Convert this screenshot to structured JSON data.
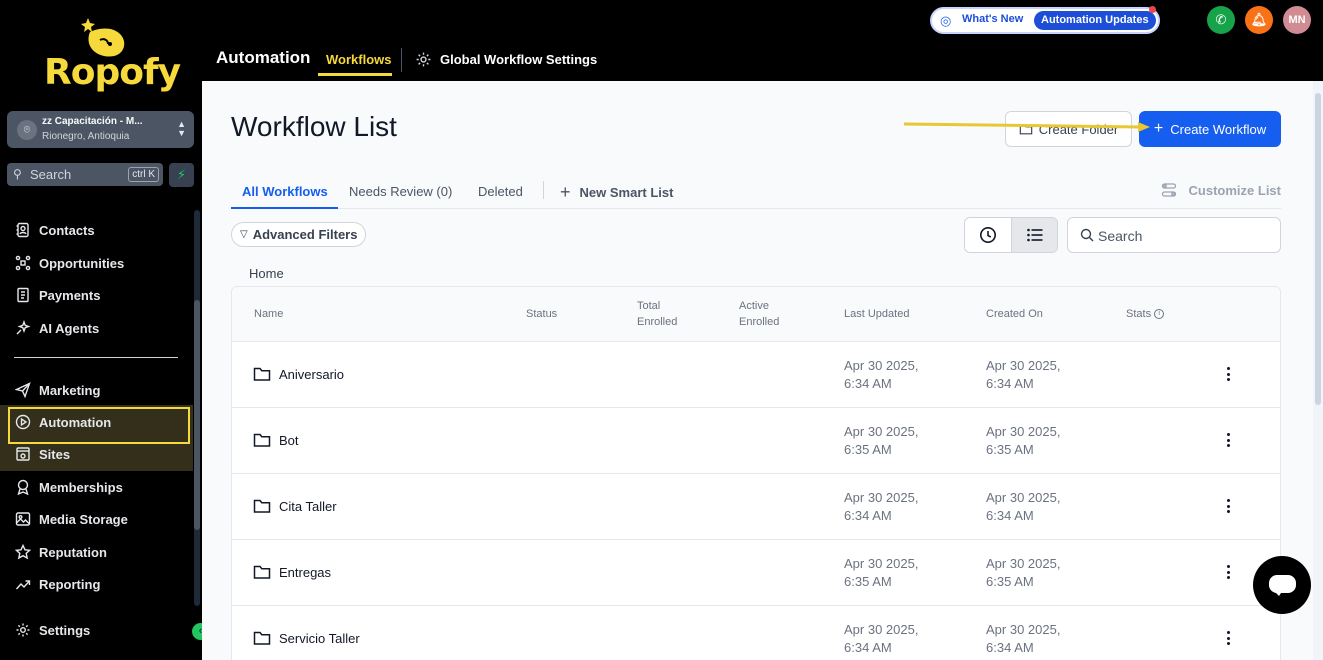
{
  "brand": {
    "logo_text": "Ropofy",
    "accent": "#f6d93b"
  },
  "account": {
    "name": "zz Capacitación - M...",
    "location": "Rionegro, Antioquia"
  },
  "sidebar": {
    "search_placeholder": "Search",
    "search_shortcut": "ctrl K",
    "items": [
      {
        "label": "Contacts",
        "icon": "contacts-icon"
      },
      {
        "label": "Opportunities",
        "icon": "opportunities-icon"
      },
      {
        "label": "Payments",
        "icon": "payments-icon"
      },
      {
        "label": "AI Agents",
        "icon": "ai-agents-icon"
      },
      {
        "label": "Marketing",
        "icon": "marketing-icon"
      },
      {
        "label": "Automation",
        "icon": "automation-icon",
        "active": true
      },
      {
        "label": "Sites",
        "icon": "sites-icon"
      },
      {
        "label": "Memberships",
        "icon": "memberships-icon"
      },
      {
        "label": "Media Storage",
        "icon": "media-storage-icon"
      },
      {
        "label": "Reputation",
        "icon": "reputation-icon"
      },
      {
        "label": "Reporting",
        "icon": "reporting-icon"
      },
      {
        "label": "Settings",
        "icon": "settings-icon"
      }
    ]
  },
  "header": {
    "whats_new": "What's New",
    "automation_updates": "Automation Updates",
    "avatar_initials": "MN",
    "app_title": "Automation",
    "tabs": [
      {
        "label": "Workflows",
        "active": true
      },
      {
        "label": "Global Workflow Settings"
      }
    ]
  },
  "main": {
    "title": "Workflow List",
    "create_folder": "Create Folder",
    "create_workflow": "Create Workflow",
    "tabs": [
      "All Workflows",
      "Needs Review (0)",
      "Deleted"
    ],
    "new_smart_list": "New Smart List",
    "customize_list": "Customize List",
    "advanced_filters": "Advanced Filters",
    "search_placeholder": "Search",
    "breadcrumb": "Home",
    "columns": [
      "Name",
      "Status",
      "Total Enrolled",
      "Active Enrolled",
      "Last Updated",
      "Created On",
      "Stats"
    ],
    "rows": [
      {
        "name": "Aniversario",
        "last_updated": "Apr 30 2025, 6:34 AM",
        "created_on": "Apr 30 2025, 6:34 AM"
      },
      {
        "name": "Bot",
        "last_updated": "Apr 30 2025, 6:35 AM",
        "created_on": "Apr 30 2025, 6:35 AM"
      },
      {
        "name": "Cita Taller",
        "last_updated": "Apr 30 2025, 6:34 AM",
        "created_on": "Apr 30 2025, 6:34 AM"
      },
      {
        "name": "Entregas",
        "last_updated": "Apr 30 2025, 6:35 AM",
        "created_on": "Apr 30 2025, 6:35 AM"
      },
      {
        "name": "Servicio Taller",
        "last_updated": "Apr 30 2025, 6:34 AM",
        "created_on": "Apr 30 2025, 6:34 AM"
      }
    ]
  },
  "colors": {
    "primary": "#155eef",
    "highlight": "#f6d93b",
    "phone": "#16a34a",
    "bell": "#f97316",
    "avatar": "#d08b93"
  }
}
